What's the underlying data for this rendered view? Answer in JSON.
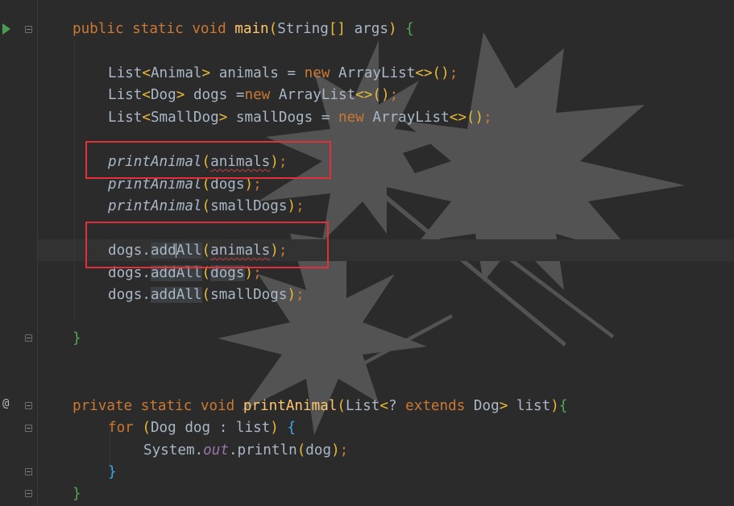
{
  "editor": {
    "language": "java",
    "theme_colors": {
      "background": "#2b2b2b",
      "keyword": "#cc7832",
      "method_declaration": "#ffc66d",
      "text": "#a9b7c6",
      "static_field": "#9876aa",
      "error_underline": "#bc3f3c",
      "annotation_box": "#e0313b",
      "run_icon": "#499c54"
    },
    "gutter": {
      "run_icon": "run-icon",
      "fold_icon": "fold-icon",
      "override_icon": "override-icon",
      "override_symbol": "@"
    },
    "code_tokens": {
      "public": "public",
      "private": "private",
      "static": "static",
      "void": "void",
      "new": "new",
      "for": "for",
      "extends": "extends",
      "main": "main",
      "String": "String",
      "args": "args",
      "List": "List",
      "Animal": "Animal",
      "Dog": "Dog",
      "SmallDog": "SmallDog",
      "ArrayList": "ArrayList",
      "animals": "animals",
      "dogs": "dogs",
      "smallDogs": "smallDogs",
      "printAnimal": "printAnimal",
      "add": "add",
      "All": "All",
      "addAll": "addAll",
      "dog": "dog",
      "list": "list",
      "System": "System",
      "out": "out",
      "println": "println",
      "wildcard": "?"
    },
    "annotations": [
      "red-box-printAnimal-animals",
      "red-box-dogs-addAll-animals"
    ],
    "background_image": "maple-leaf-watermark"
  }
}
